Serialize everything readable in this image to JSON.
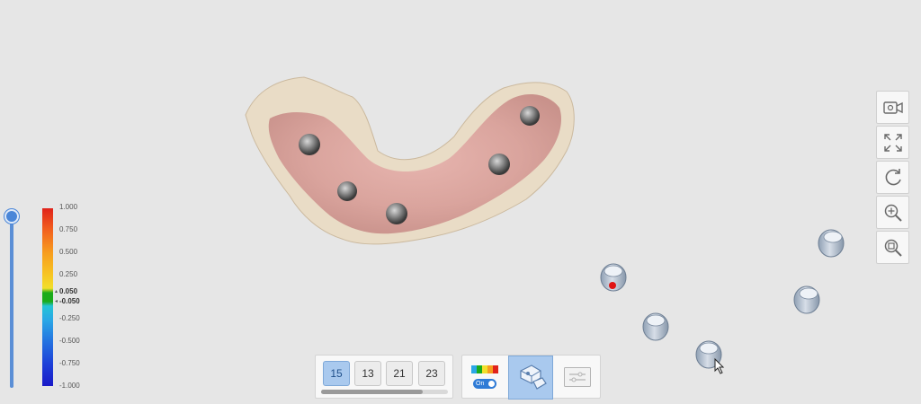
{
  "viewport": {
    "model_name": "3d-jaw-scan",
    "scan_bodies_count": 5
  },
  "colorbar": {
    "labels": [
      "1.000",
      "0.750",
      "0.500",
      "0.250",
      "0.050",
      "-0.050",
      "-0.250",
      "-0.500",
      "-0.750",
      "-1.000"
    ],
    "colors": {
      "high": "#e0231b",
      "tolerance": "#1bab1b",
      "low": "#1a1ac8"
    }
  },
  "right_toolbar": {
    "items": [
      {
        "name": "record-video-icon"
      },
      {
        "name": "fit-to-screen-icon"
      },
      {
        "name": "reset-view-icon"
      },
      {
        "name": "zoom-in-icon"
      },
      {
        "name": "zoom-fit-icon"
      }
    ]
  },
  "tooth_selector": {
    "teeth": [
      "15",
      "13",
      "21",
      "23"
    ],
    "active": "15",
    "scroll_fraction": 0.8
  },
  "display_controls": {
    "toggle_label": "On",
    "active_mode": "abutment-view"
  },
  "accent_color": "#4a86d8"
}
